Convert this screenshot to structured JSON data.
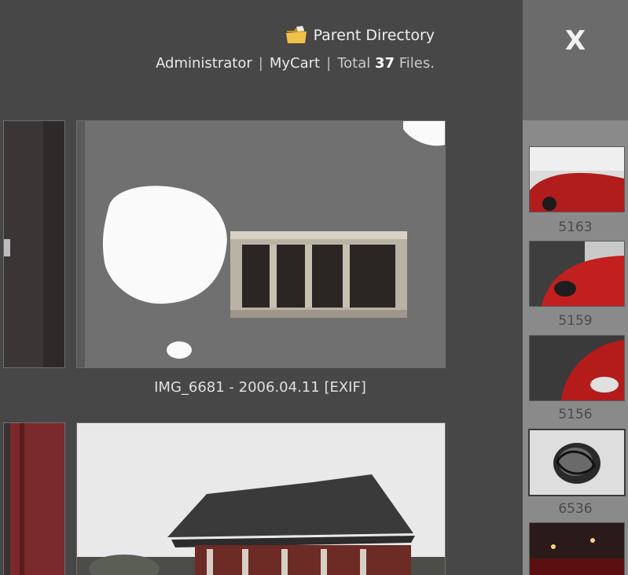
{
  "header": {
    "parent_directory": "Parent Directory",
    "user": "Administrator",
    "cart": "MyCart",
    "total_prefix": "Total",
    "total_count": "37",
    "total_suffix": "Files."
  },
  "close_label": "X",
  "current_photo": {
    "caption": "IMG_6681 - 2006.04.11",
    "exif_label": "[EXIF]"
  },
  "thumbnails": [
    {
      "label": "5163"
    },
    {
      "label": "5159"
    },
    {
      "label": "5156"
    },
    {
      "label": "6536"
    }
  ],
  "icons": {
    "folder": "folder-icon",
    "close": "close-icon"
  },
  "colors": {
    "main_bg": "#474747",
    "sidebar_bg": "#8a8a8a",
    "sidebar_top_bg": "#6b6b6b",
    "folder_yellow": "#e9b73a"
  }
}
